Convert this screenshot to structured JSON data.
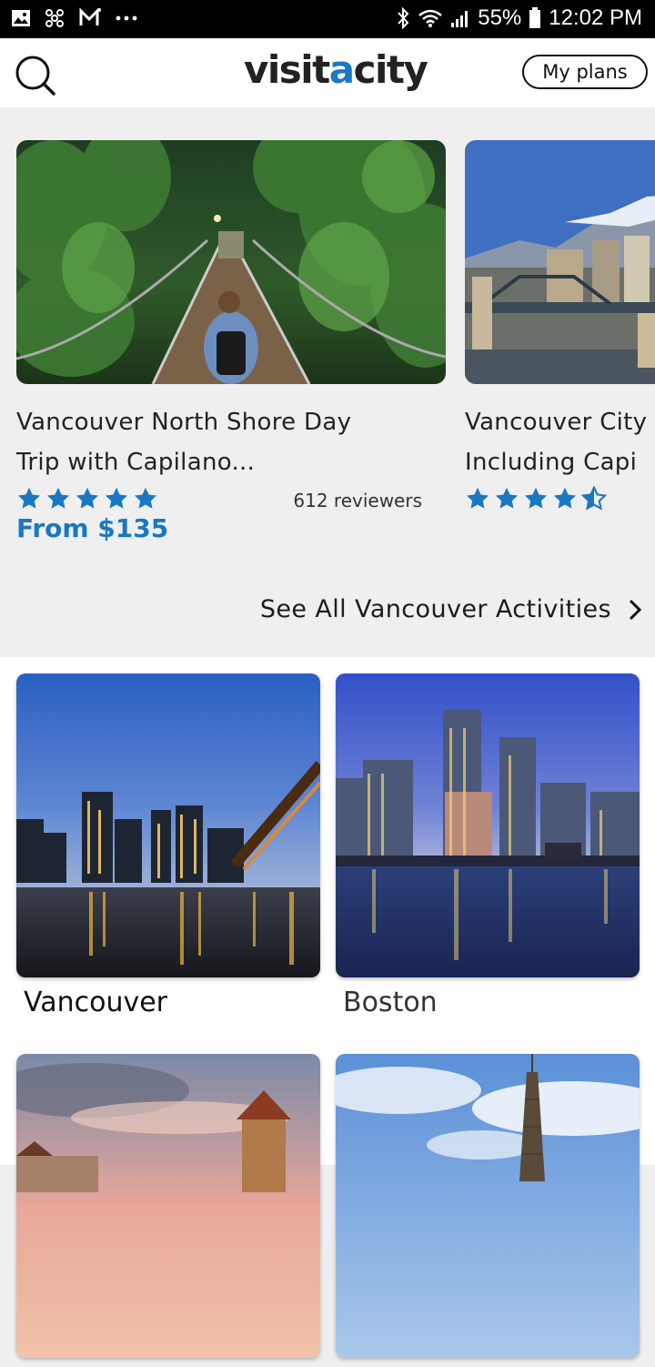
{
  "status_bar": {
    "battery": "55%",
    "time": "12:02 PM",
    "icons": [
      "gallery-icon",
      "pinwheel-icon",
      "gmail-icon",
      "more-dots-icon",
      "bluetooth-icon",
      "wifi-icon",
      "signal-icon",
      "battery-icon"
    ]
  },
  "header": {
    "logo_prefix": "visit",
    "logo_accent": "a",
    "logo_suffix": "city",
    "my_plans_label": "My plans",
    "accent_color": "#1a78c2"
  },
  "activities": [
    {
      "title_line1": "Vancouver North Shore Day",
      "title_line2": "Trip with Capilano...",
      "rating": 5,
      "reviewers": "612 reviewers",
      "price": "From $135"
    },
    {
      "title_line1": "Vancouver City",
      "title_line2": "Including Capi",
      "rating": 4.5
    }
  ],
  "see_all_label": "See All Vancouver Activities",
  "cities": [
    {
      "name": "Vancouver"
    },
    {
      "name": "Boston"
    },
    {
      "name": ""
    },
    {
      "name": ""
    }
  ]
}
